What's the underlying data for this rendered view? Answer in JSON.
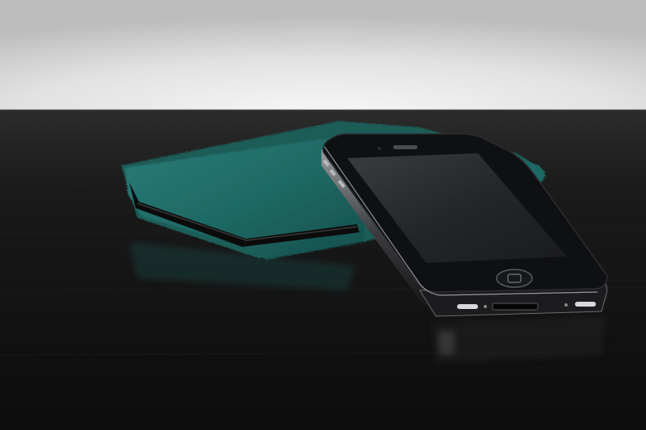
{
  "scene": {
    "subjects": [
      "smartphone",
      "knitted-phone-sleeve",
      "table-surface",
      "wall-background"
    ],
    "colors": {
      "wall_top": "#cfcfcf",
      "wall_glow": "#f4f4f4",
      "table": "#141414",
      "table_highlight": "#2e2e2e",
      "sleeve": "#1f6a66",
      "sleeve_dark": "#12403e",
      "sleeve_lining": "#0b0b0b",
      "phone_body": "#0d0d0f",
      "phone_screen": "#2a2c30",
      "phone_bezel": "#3b3d42",
      "phone_edge": "#8a8c90"
    }
  }
}
